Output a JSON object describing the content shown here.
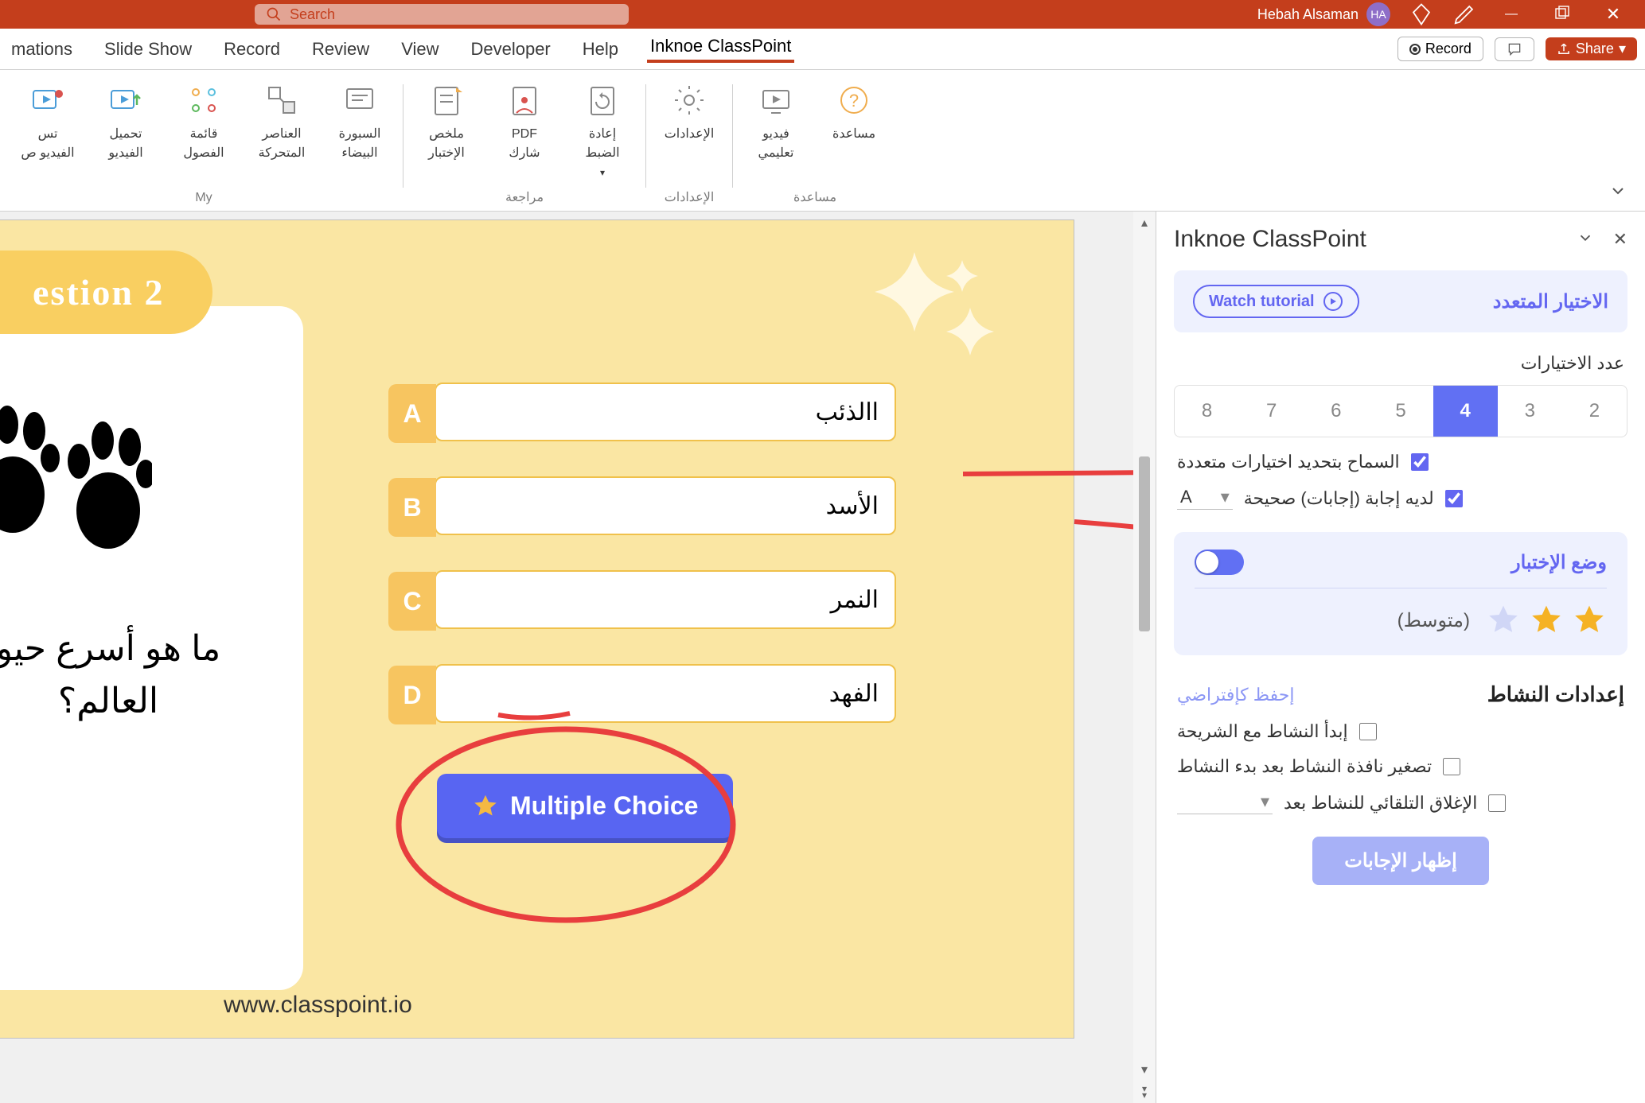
{
  "titlebar": {
    "search_placeholder": "Search",
    "user_name": "Hebah Alsaman",
    "user_initials": "HA"
  },
  "tabs": {
    "items": [
      "mations",
      "Slide Show",
      "Record",
      "Review",
      "View",
      "Developer",
      "Help",
      "Inknoe ClassPoint"
    ],
    "active_index": 7,
    "record_label": "Record",
    "share_label": "Share"
  },
  "ribbon": {
    "groups": [
      {
        "label": "My",
        "items": [
          {
            "line1": "تس",
            "line2": "الفيديو ص"
          },
          {
            "line1": "تحميل",
            "line2": "الفيديو"
          },
          {
            "line1": "قائمة",
            "line2": "الفصول"
          },
          {
            "line1": "العناصر",
            "line2": "المتحركة"
          },
          {
            "line1": "السبورة",
            "line2": "البيضاء"
          }
        ]
      },
      {
        "label": "مراجعة",
        "items": [
          {
            "line1": "ملخص",
            "line2": "الإختبار"
          },
          {
            "line1": "PDF",
            "line2": "شارك"
          },
          {
            "line1": "إعادة",
            "line2": "الضبط"
          }
        ]
      },
      {
        "label": "الإعدادات",
        "items": [
          {
            "line1": "الإعدادات",
            "line2": ""
          }
        ]
      },
      {
        "label": "مساعدة",
        "items": [
          {
            "line1": "فيديو",
            "line2": "تعليمي"
          },
          {
            "line1": "مساعدة",
            "line2": ""
          }
        ]
      }
    ]
  },
  "slide": {
    "banner": "estion 2",
    "question_l1": "ما هو أسرع حيو",
    "question_l2": "العالم؟",
    "answers": [
      {
        "label": "A",
        "text": "االذئب"
      },
      {
        "label": "B",
        "text": "الأسد"
      },
      {
        "label": "C",
        "text": "النمر"
      },
      {
        "label": "D",
        "text": "الفهد"
      }
    ],
    "mc_button": "Multiple Choice",
    "footer": "www.classpoint.io"
  },
  "panel": {
    "title": "Inknoe ClassPoint",
    "watch_tutorial": "Watch tutorial",
    "section_title": "الاختيار المتعدد",
    "choices_label": "عدد الاختيارات",
    "choice_numbers": [
      "8",
      "7",
      "6",
      "5",
      "4",
      "3",
      "2"
    ],
    "choice_selected_index": 4,
    "allow_multi": "السماح بتحديد اختيارات متعددة",
    "has_correct_prefix": "لديه إجابة (إجابات) صحيحة",
    "correct_letter": "A",
    "quiz_mode": "وضع الإختبار",
    "difficulty": "(متوسط)",
    "activity_title": "إعدادات النشاط",
    "save_default": "إحفظ كإفتراضي",
    "opt_start": "إبدأ النشاط مع الشريحة",
    "opt_minimize": "تصغير نافذة النشاط بعد بدء النشاط",
    "opt_autoclose": "الإغلاق التلقائي للنشاط بعد",
    "show_answers": "إظهار الإجابات"
  }
}
